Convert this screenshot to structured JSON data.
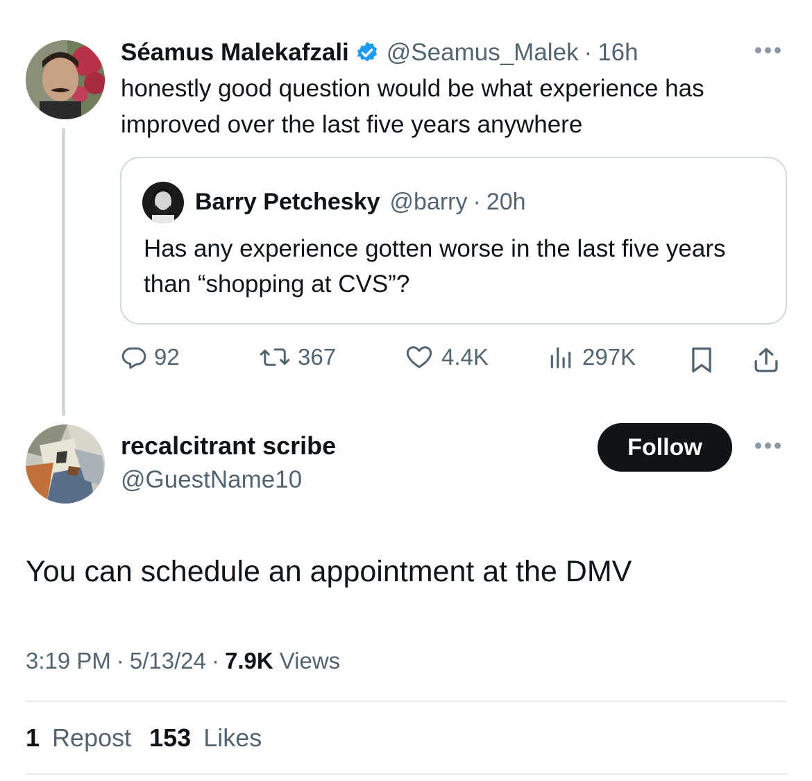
{
  "parent": {
    "name": "Séamus Malekafzali",
    "handle": "@Seamus_Malek",
    "separator": "·",
    "time": "16h",
    "text": "honestly good question would be what experience has improved over the last five years anywhere",
    "verified_color": "#1d9bf0",
    "quote": {
      "name": "Barry Petchesky",
      "handle": "@barry",
      "separator": "·",
      "time": "20h",
      "text": "Has any experience gotten worse in the last five years than “shopping at CVS”?"
    },
    "actions": {
      "replies": "92",
      "reposts": "367",
      "likes": "4.4K",
      "views": "297K"
    }
  },
  "reply": {
    "name": "recalcitrant scribe",
    "handle": "@GuestName10",
    "follow_label": "Follow",
    "text": "You can schedule an appointment at the DMV",
    "meta": {
      "time": "3:19 PM",
      "sep1": "·",
      "date": "5/13/24",
      "sep2": "·",
      "views_count": "7.9K",
      "views_label": "Views"
    },
    "stats": {
      "reposts_count": "1",
      "reposts_label": "Repost",
      "likes_count": "153",
      "likes_label": "Likes"
    }
  },
  "colors": {
    "text_primary": "#0f1419",
    "text_secondary": "#536471",
    "border": "#cfd9de",
    "verified": "#1d9bf0"
  },
  "icons": [
    "more-icon",
    "verified-badge-icon",
    "reply-icon",
    "repost-icon",
    "like-icon",
    "views-icon",
    "bookmark-icon",
    "share-icon"
  ]
}
